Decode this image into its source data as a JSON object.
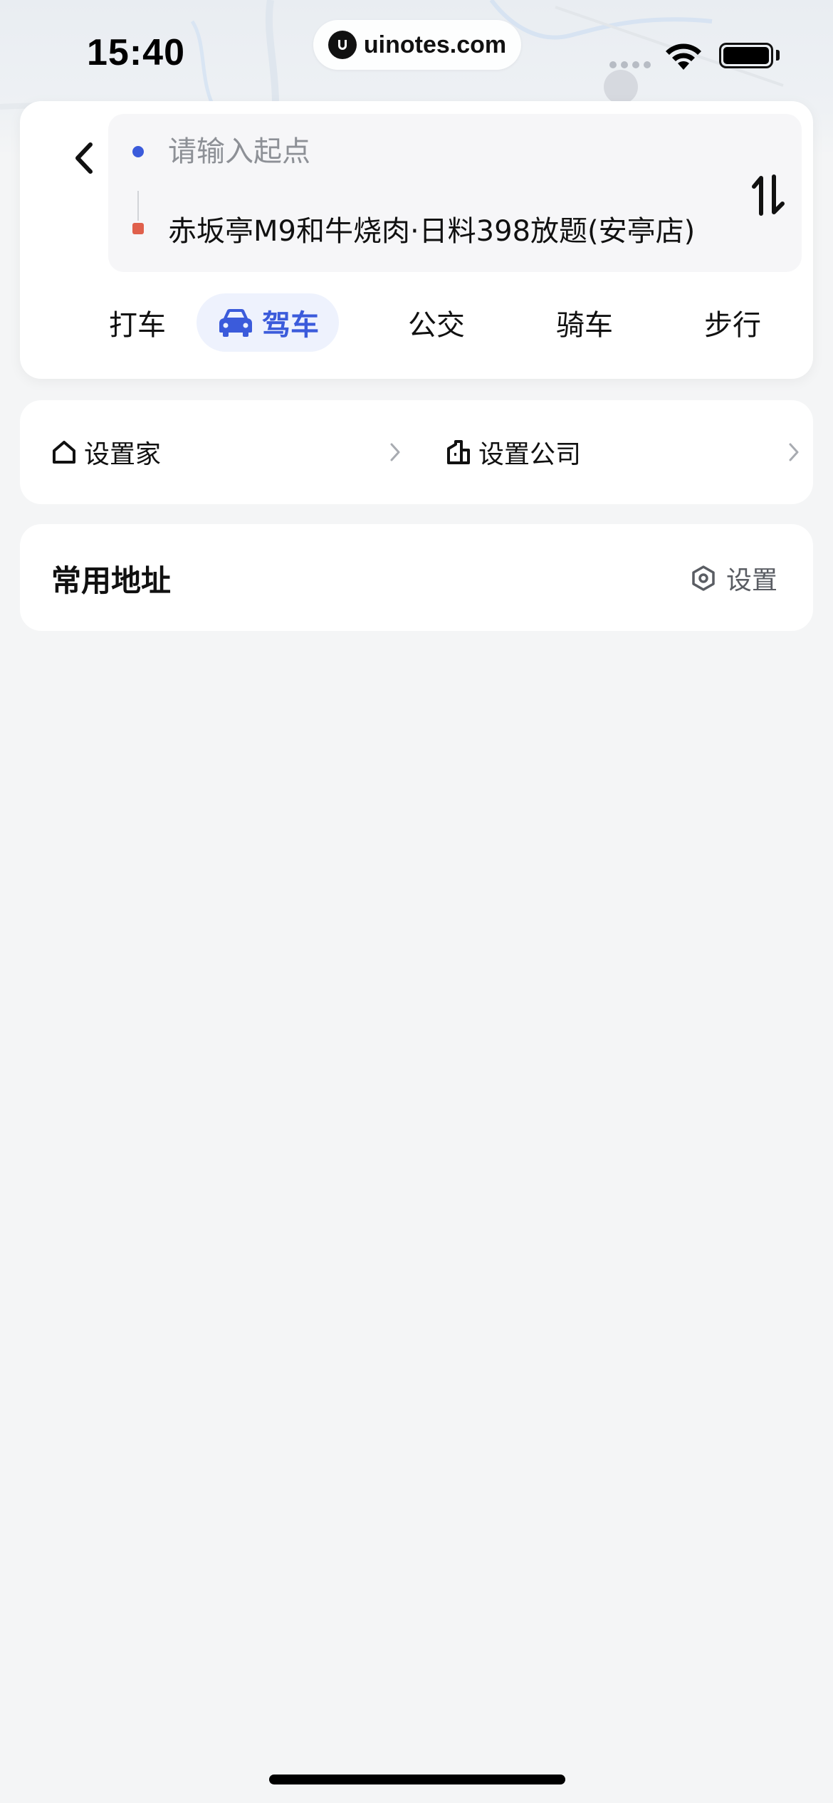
{
  "status_bar": {
    "time": "15:40",
    "url": "uinotes.com"
  },
  "route": {
    "start_placeholder": "请输入起点",
    "destination": "赤坂亭M9和牛烧肉·日料398放题(安亭店)",
    "start_dot_color": "#3b5bdb",
    "end_dot_color": "#e0604c"
  },
  "modes": [
    {
      "label": "打车",
      "active": false
    },
    {
      "label": "驾车",
      "active": true,
      "icon": "car-icon"
    },
    {
      "label": "公交",
      "active": false
    },
    {
      "label": "骑车",
      "active": false
    },
    {
      "label": "步行",
      "active": false
    }
  ],
  "accent_color": "#3b5bdb",
  "shortcuts": {
    "home_label": "设置家",
    "work_label": "设置公司"
  },
  "common": {
    "title": "常用地址",
    "settings_label": "设置"
  }
}
